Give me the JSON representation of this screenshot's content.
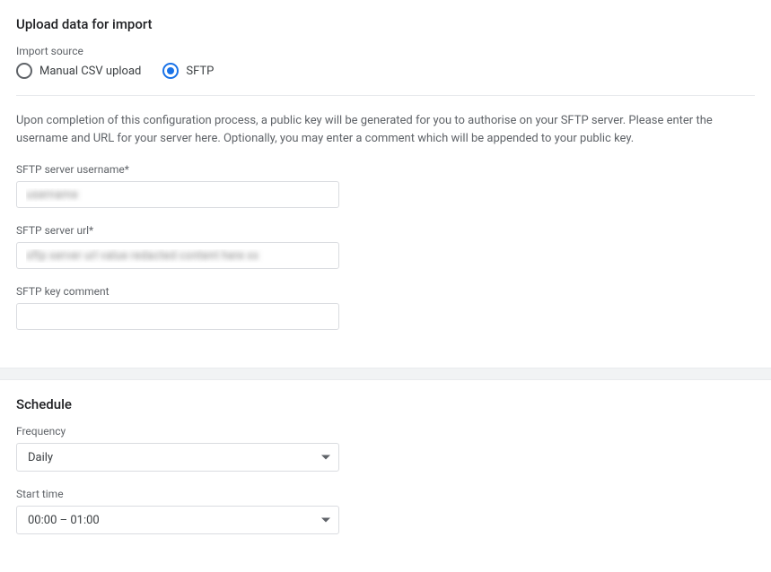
{
  "upload": {
    "title": "Upload data for import",
    "sourceLabel": "Import source",
    "options": {
      "manual": "Manual CSV upload",
      "sftp": "SFTP"
    },
    "description": "Upon completion of this configuration process, a public key will be generated for you to authorise on your SFTP server. Please enter the username and URL for your server here. Optionally, you may enter a comment which will be appended to your public key.",
    "fields": {
      "usernameLabel": "SFTP server username*",
      "usernameValue": "username",
      "urlLabel": "SFTP server url*",
      "urlValue": "sftp server url value redacted content here xx",
      "commentLabel": "SFTP key comment",
      "commentValue": ""
    }
  },
  "schedule": {
    "title": "Schedule",
    "frequencyLabel": "Frequency",
    "frequencyValue": "Daily",
    "startLabel": "Start time",
    "startValue": "00:00 – 01:00"
  }
}
